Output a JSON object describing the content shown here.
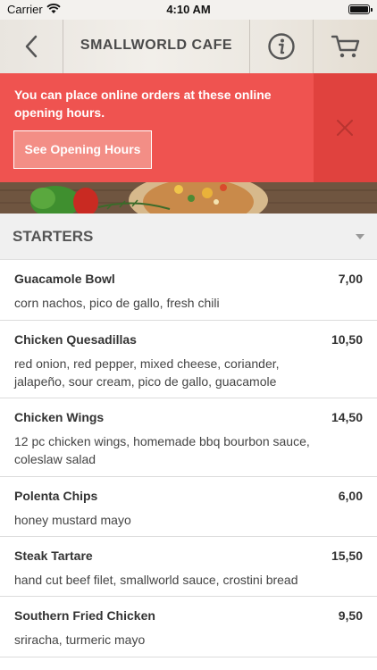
{
  "status_bar": {
    "carrier": "Carrier",
    "time": "4:10 AM"
  },
  "header": {
    "title": "SMALLWORLD CAFE"
  },
  "banner": {
    "message": "You can place online orders at these online opening hours.",
    "button_label": "See Opening Hours",
    "color": "#ef5350"
  },
  "category": {
    "title": "STARTERS"
  },
  "menu_items": [
    {
      "name": "Guacamole Bowl",
      "price": "7,00",
      "description": "corn nachos, pico de gallo, fresh chili"
    },
    {
      "name": "Chicken Quesadillas",
      "price": "10,50",
      "description": "red onion, red pepper, mixed cheese, coriander, jalapeño, sour cream, pico de gallo, guacamole"
    },
    {
      "name": "Chicken Wings",
      "price": "14,50",
      "description": "12 pc chicken wings, homemade bbq bourbon sauce, coleslaw salad"
    },
    {
      "name": "Polenta Chips",
      "price": "6,00",
      "description": "honey mustard mayo"
    },
    {
      "name": "Steak Tartare",
      "price": "15,50",
      "description": "hand cut beef filet, smallworld sauce, crostini bread"
    },
    {
      "name": "Southern Fried Chicken",
      "price": "9,50",
      "description": "sriracha, turmeric mayo"
    }
  ],
  "icons": [
    "wifi-icon",
    "battery-icon",
    "back-chevron-icon",
    "info-icon",
    "cart-icon",
    "close-icon",
    "dropdown-chevron-icon"
  ]
}
